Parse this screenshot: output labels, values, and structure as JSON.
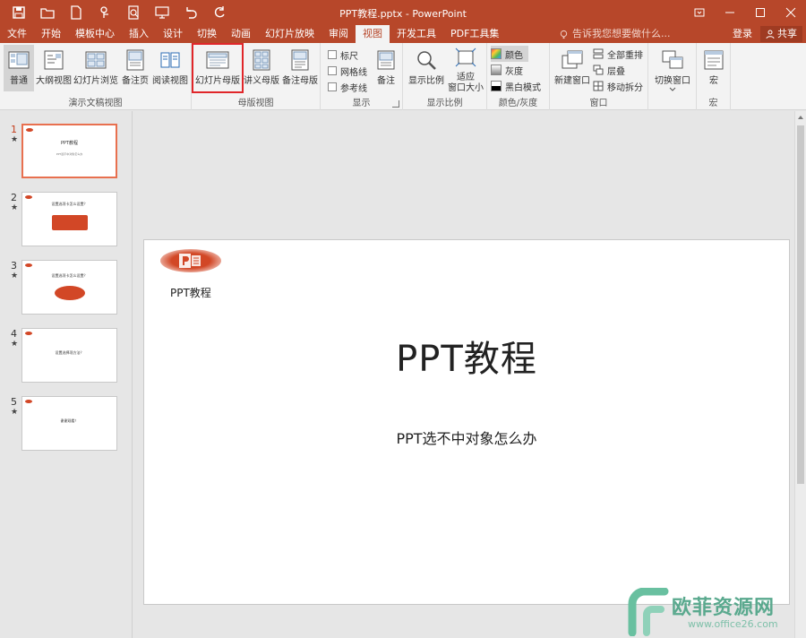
{
  "window": {
    "title": "PPT教程.pptx - PowerPoint"
  },
  "quick_access": [
    {
      "icon": "save-icon"
    },
    {
      "icon": "open-folder-icon"
    },
    {
      "icon": "new-file-icon"
    },
    {
      "icon": "touch-mode-icon"
    },
    {
      "icon": "print-preview-icon"
    },
    {
      "icon": "slideshow-from-start-icon"
    },
    {
      "icon": "undo-icon"
    },
    {
      "icon": "redo-icon"
    }
  ],
  "tabs": [
    {
      "label": "文件"
    },
    {
      "label": "开始"
    },
    {
      "label": "模板中心"
    },
    {
      "label": "插入"
    },
    {
      "label": "设计"
    },
    {
      "label": "切换"
    },
    {
      "label": "动画"
    },
    {
      "label": "幻灯片放映"
    },
    {
      "label": "审阅"
    },
    {
      "label": "视图",
      "active": true
    },
    {
      "label": "开发工具"
    },
    {
      "label": "PDF工具集"
    }
  ],
  "tell_me": "告诉我您想要做什么...",
  "login": "登录",
  "share": "共享",
  "ribbon": {
    "groups": {
      "presentation_views": "演示文稿视图",
      "master_views": "母版视图",
      "show": "显示",
      "zoom": "显示比例",
      "color": "颜色/灰度",
      "window": "窗口",
      "macros": "宏"
    },
    "buttons": {
      "normal": "普通",
      "outline": "大纲视图",
      "slide_sorter": "幻灯片浏览",
      "notes_page": "备注页",
      "reading_view": "阅读视图",
      "slide_master": "幻灯片母版",
      "handout_master": "讲义母版",
      "notes_master": "备注母版",
      "ruler": "标尺",
      "gridlines": "网格线",
      "guides": "参考线",
      "notes": "备注",
      "zoom": "显示比例",
      "fit_window_1": "适应",
      "fit_window_2": "窗口大小",
      "color": "颜色",
      "grayscale": "灰度",
      "black_white": "黑白模式",
      "new_window": "新建窗口",
      "arrange_all": "全部重排",
      "cascade": "层叠",
      "move_split": "移动拆分",
      "switch_windows": "切换窗口",
      "macros": "宏"
    }
  },
  "slides": [
    {
      "num": "1",
      "title": "PPT教程",
      "subtitle": "PPT选不中对象怎么办",
      "logo_text": "PPT教程"
    },
    {
      "num": "2",
      "title": "设置选项卡怎么设置？"
    },
    {
      "num": "3",
      "title": "设置选项卡怎么设置？"
    },
    {
      "num": "4",
      "title": "设置选择项方法？"
    },
    {
      "num": "5",
      "title": "谢谢观看！"
    }
  ],
  "watermark": {
    "text": "欧菲资源网",
    "url": "www.office26.com"
  },
  "colors": {
    "brand": "#b7472a",
    "accent": "#d24726",
    "highlight_box": "#e0262a"
  }
}
